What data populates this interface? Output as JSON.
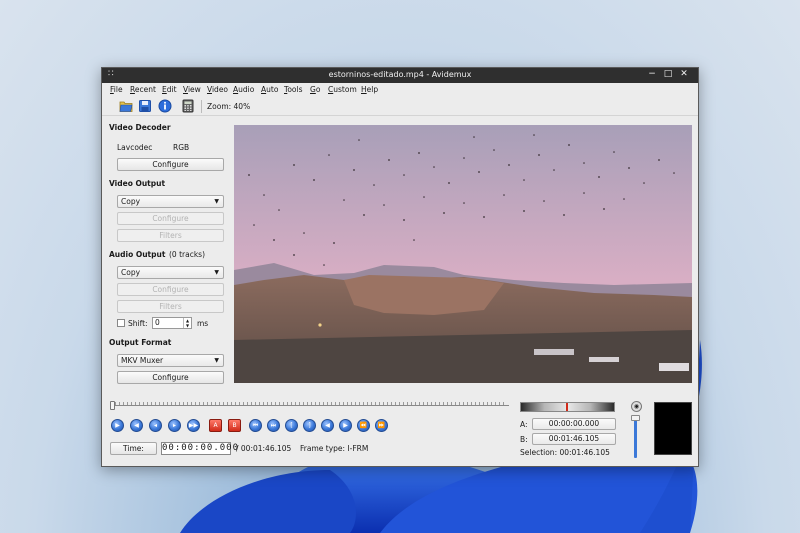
{
  "window": {
    "title": "estorninos-editado.mp4 - Avidemux",
    "menu_dots": "∷",
    "min": "−",
    "max": "□",
    "close": "✕"
  },
  "menu": [
    "File",
    "Recent",
    "Edit",
    "View",
    "Video",
    "Audio",
    "Auto",
    "Tools",
    "Go",
    "Custom",
    "Help"
  ],
  "toolbar": {
    "icons": [
      "open-folder-icon",
      "save-icon",
      "info-icon",
      "calculator-icon"
    ],
    "zoom": "Zoom: 40%"
  },
  "video_decoder": {
    "title": "Video Decoder",
    "codec": "Lavcodec",
    "colorspace": "RGB",
    "configure": "Configure"
  },
  "video_output": {
    "title": "Video Output",
    "selected": "Copy",
    "configure": "Configure",
    "filters": "Filters"
  },
  "audio_output": {
    "title": "Audio Output",
    "tracks": "(0 tracks)",
    "selected": "Copy",
    "configure": "Configure",
    "filters": "Filters",
    "shift_label": "Shift:",
    "shift_value": "0",
    "shift_unit": "ms"
  },
  "output_format": {
    "title": "Output Format",
    "selected": "MKV Muxer",
    "configure": "Configure"
  },
  "playback": {
    "time_button": "Time:",
    "current_time": "00:00:00.000",
    "total_time": "/ 00:01:46.105",
    "frame_type": "Frame type:  I-FRM",
    "position": 0.0
  },
  "markers": {
    "a_label": "A:",
    "a_value": "00:00:00.000",
    "b_label": "B:",
    "b_value": "00:01:46.105",
    "selection": "Selection: 00:01:46.105"
  },
  "colors": {
    "titlebar": "#2f2f2f",
    "accent_blue": "#3b78d8",
    "marker_red": "#d12b1a",
    "sky_top": "#a89fb8",
    "sky_bottom": "#e0b6c8"
  }
}
